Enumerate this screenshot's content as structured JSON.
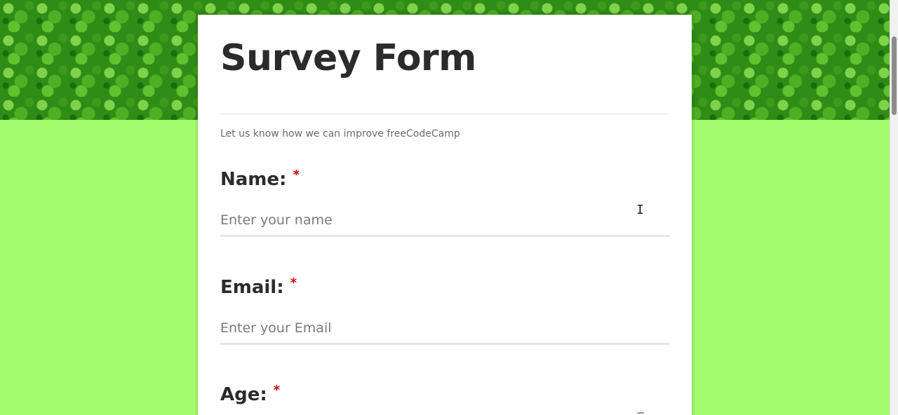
{
  "form": {
    "title": "Survey Form",
    "description": "Let us know how we can improve freeCodeCamp",
    "required_marker": "*",
    "fields": [
      {
        "label": "Name:",
        "placeholder": "Enter your name"
      },
      {
        "label": "Email:",
        "placeholder": "Enter your Email"
      },
      {
        "label": "Age:"
      }
    ]
  },
  "icons": {
    "cursor": "text-cursor-icon"
  }
}
